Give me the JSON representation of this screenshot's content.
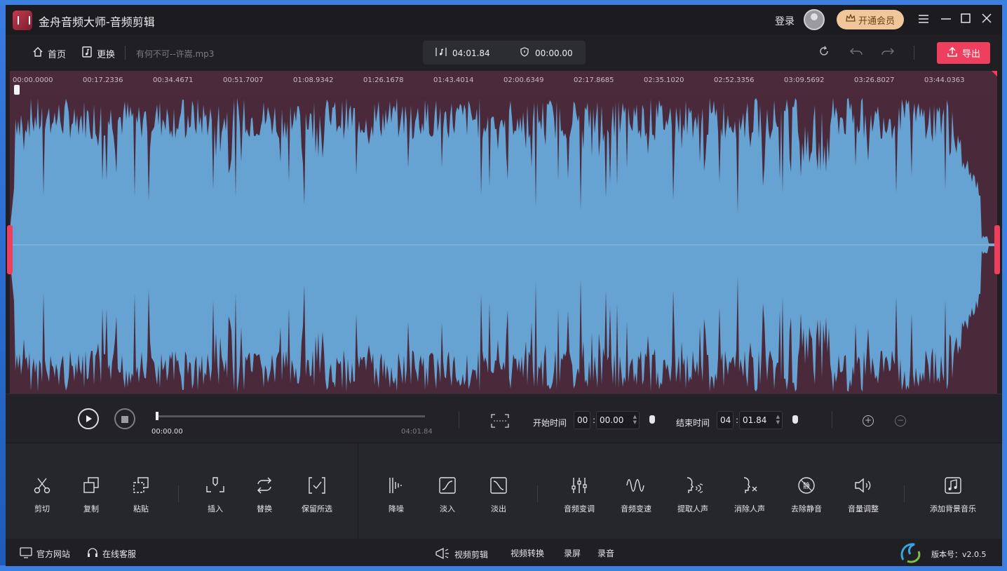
{
  "app": {
    "title": "金舟音频大师-音频剪辑",
    "login": "登录",
    "vip": "开通会员"
  },
  "toolbar": {
    "home": "首页",
    "replace": "更换",
    "filename": "有何不可--许嵩.mp3",
    "duration": "04:01.84",
    "selection": "00:00.00",
    "export": "导出"
  },
  "ruler": {
    "ticks": [
      "00:00.0000",
      "00:17.2336",
      "00:34.4671",
      "00:51.7007",
      "01:08.9342",
      "01:26.1678",
      "01:43.4014",
      "02:00.6349",
      "02:17.8685",
      "02:35.1020",
      "02:52.3356",
      "03:09.5692",
      "03:26.8027",
      "03:44.0363"
    ]
  },
  "playback": {
    "current": "00:00.00",
    "total": "04:01.84",
    "progress": 0,
    "start_label": "开始时间",
    "start_min": "00",
    "start_sec": "00.00",
    "end_label": "结束时间",
    "end_min": "04",
    "end_sec": "01.84"
  },
  "tools": {
    "cut": "剪切",
    "copy": "复制",
    "paste": "粘贴",
    "insert": "插入",
    "swap": "替换",
    "keep": "保留所选",
    "denoise": "降噪",
    "fadein": "淡入",
    "fadeout": "淡出",
    "pitch": "音频变调",
    "speed": "音频变速",
    "extract_voice": "提取人声",
    "remove_voice": "消除人声",
    "remove_silence": "去除静音",
    "volume": "音量调整",
    "bgm": "添加背景音乐"
  },
  "footer": {
    "website": "官方网站",
    "support": "在线客服",
    "video_edit": "视频剪辑",
    "video_convert": "视频转换",
    "record_screen": "录屏",
    "record_audio": "录音",
    "version": "版本号：v2.0.5"
  },
  "colors": {
    "accent": "#ef3f5f",
    "wave": "#66a3d2",
    "wave_bg": "#4a2a3a",
    "vip": "#f0c79a"
  }
}
